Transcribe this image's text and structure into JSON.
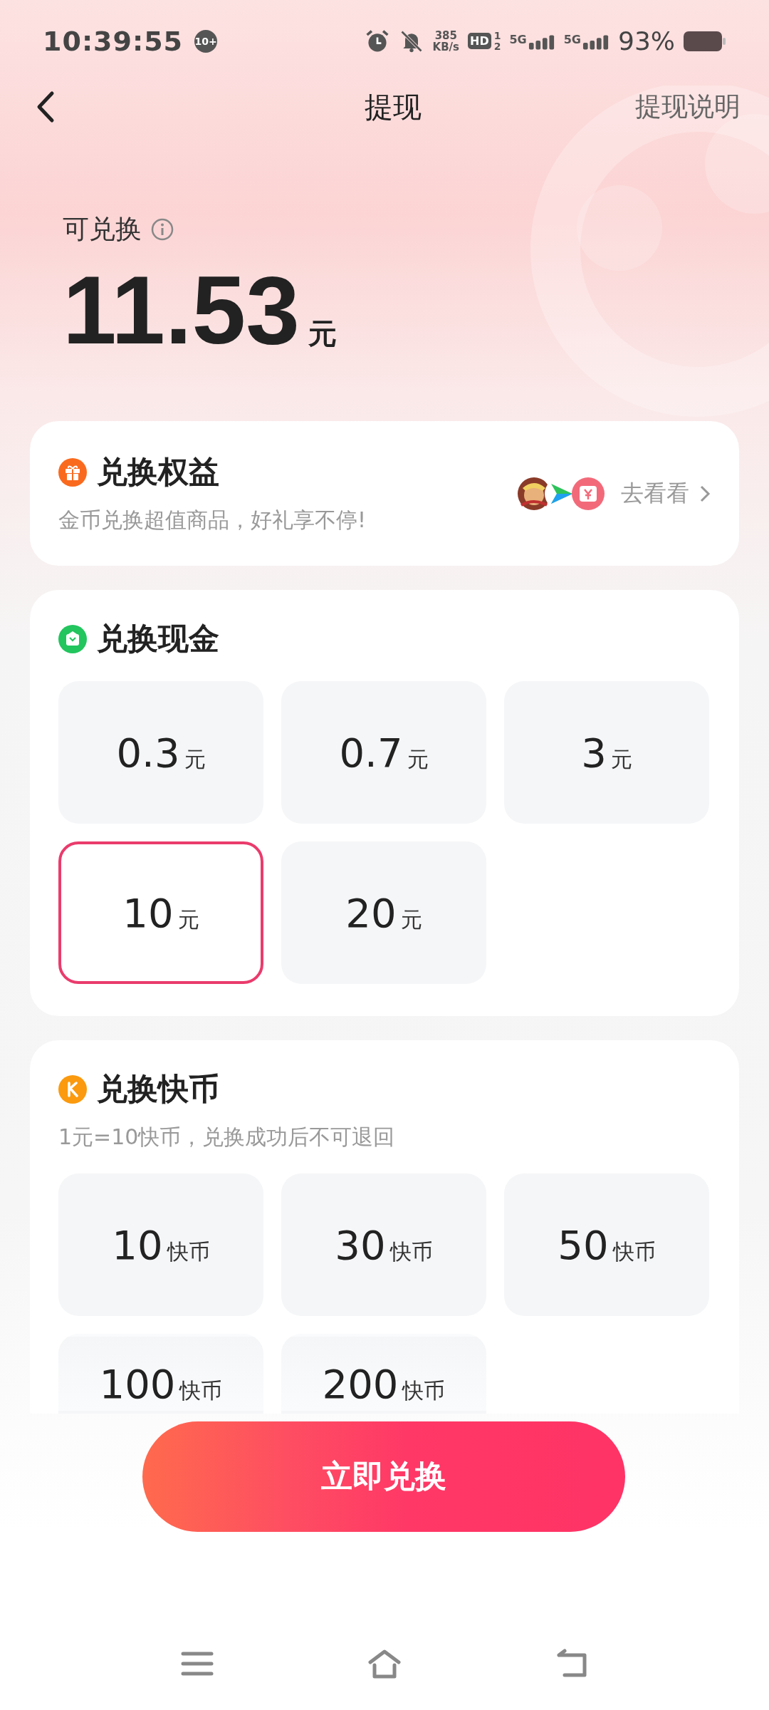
{
  "status_bar": {
    "time": "10:39:55",
    "notification_badge": "10+",
    "speed_value": "385",
    "speed_unit": "KB/s",
    "hd": "HD",
    "sim_slots": [
      "1",
      "2"
    ],
    "networks": [
      "5G",
      "5G"
    ],
    "battery": "93%"
  },
  "header": {
    "title": "提现",
    "action": "提现说明"
  },
  "balance": {
    "label": "可兑换",
    "amount": "11.53",
    "unit": "元"
  },
  "benefits": {
    "title": "兑换权益",
    "subtitle": "金币兑换超值商品，好礼享不停!",
    "link": "去看看"
  },
  "cash": {
    "title": "兑换现金",
    "options": [
      {
        "value": "0.3",
        "unit": "元",
        "selected": false
      },
      {
        "value": "0.7",
        "unit": "元",
        "selected": false
      },
      {
        "value": "3",
        "unit": "元",
        "selected": false
      },
      {
        "value": "10",
        "unit": "元",
        "selected": true
      },
      {
        "value": "20",
        "unit": "元",
        "selected": false
      }
    ]
  },
  "coins": {
    "title": "兑换快币",
    "subtitle": "1元=10快币，兑换成功后不可退回",
    "options": [
      {
        "value": "10",
        "unit": "快币",
        "selected": false
      },
      {
        "value": "30",
        "unit": "快币",
        "selected": false
      },
      {
        "value": "50",
        "unit": "快币",
        "selected": false
      },
      {
        "value": "100",
        "unit": "快币",
        "selected": false
      },
      {
        "value": "200",
        "unit": "快币",
        "selected": false
      }
    ]
  },
  "submit": "立即兑换"
}
